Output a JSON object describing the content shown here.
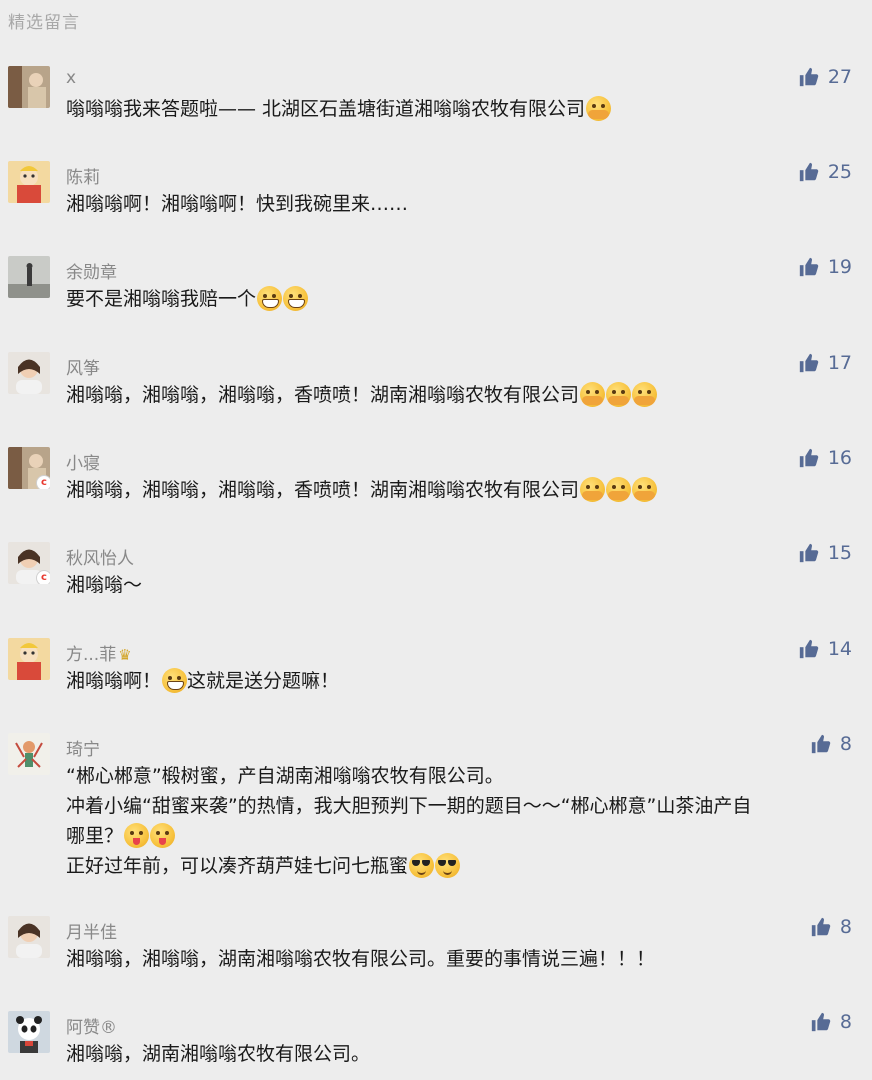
{
  "section_title": "精选留言",
  "like_color": "#576b95",
  "comments": [
    {
      "name": "x",
      "likes": "27",
      "avatar_icon": "avatar-photo-icon",
      "lines": [
        [
          "嗡嗡嗡我来答题啦—— 北湖区石盖塘街道湘嗡嗡农牧有限公司"
        ]
      ],
      "emojis": [
        [
          "hug-emoji"
        ]
      ]
    },
    {
      "name": "陈莉",
      "likes": "25",
      "avatar_icon": "avatar-cartoon-icon",
      "lines": [
        [
          "湘嗡嗡啊！湘嗡嗡啊！快到我碗里来……"
        ]
      ],
      "emojis": [
        []
      ]
    },
    {
      "name": "余勋章",
      "likes": "19",
      "avatar_icon": "avatar-landscape-icon",
      "lines": [
        [
          "要不是湘嗡嗡我赔一个"
        ]
      ],
      "emojis": [
        [
          "grin-emoji",
          "grin-emoji"
        ]
      ]
    },
    {
      "name": "风筝",
      "likes": "17",
      "avatar_icon": "avatar-portrait-icon",
      "lines": [
        [
          "湘嗡嗡，湘嗡嗡，湘嗡嗡，香喷喷！湖南湘嗡嗡农牧有限公司"
        ]
      ],
      "emojis": [
        [
          "hug-emoji",
          "hug-emoji",
          "hug-emoji"
        ]
      ]
    },
    {
      "name": "小寝",
      "likes": "16",
      "avatar_icon": "avatar-photo-icon",
      "lines": [
        [
          "湘嗡嗡，湘嗡嗡，湘嗡嗡，香喷喷！湖南湘嗡嗡农牧有限公司"
        ]
      ],
      "emojis": [
        [
          "hug-emoji",
          "hug-emoji",
          "hug-emoji"
        ]
      ]
    },
    {
      "name": "秋风怡人",
      "likes": "15",
      "avatar_icon": "avatar-portrait-icon",
      "lines": [
        [
          "湘嗡嗡～"
        ]
      ],
      "emojis": [
        []
      ]
    },
    {
      "name": "方...菲",
      "likes": "14",
      "avatar_icon": "avatar-cartoon-icon",
      "lines": [
        [
          "湘嗡嗡啊！",
          "这就是送分题嘛！"
        ]
      ],
      "emojis": [
        [
          "grin-emoji"
        ]
      ]
    },
    {
      "name": "琦宁",
      "likes": "8",
      "avatar_icon": "avatar-illustration-icon",
      "lines": [
        [
          "“郴心郴意”椴树蜜，产自湖南湘嗡嗡农牧有限公司。"
        ],
        [
          "冲着小编“甜蜜来袭”的热情，我大胆预判下一期的题目～～“郴心郴意”山茶油产自"
        ],
        [
          "哪里？"
        ],
        [
          "正好过年前，可以凑齐葫芦娃七问七瓶蜜"
        ]
      ],
      "emojis": [
        [],
        [],
        [
          "wink-emoji",
          "wink-emoji"
        ],
        [
          "cool-emoji",
          "cool-emoji"
        ]
      ]
    },
    {
      "name": "月半佳",
      "likes": "8",
      "avatar_icon": "avatar-portrait-icon",
      "lines": [
        [
          "湘嗡嗡，湘嗡嗡，湖南湘嗡嗡农牧有限公司。重要的事情说三遍！！！"
        ]
      ],
      "emojis": [
        []
      ]
    },
    {
      "name": "阿赞®",
      "likes": "8",
      "avatar_icon": "avatar-panda-icon",
      "lines": [
        [
          "湘嗡嗡，湖南湘嗡嗡农牧有限公司。"
        ]
      ],
      "emojis": [
        []
      ]
    }
  ]
}
